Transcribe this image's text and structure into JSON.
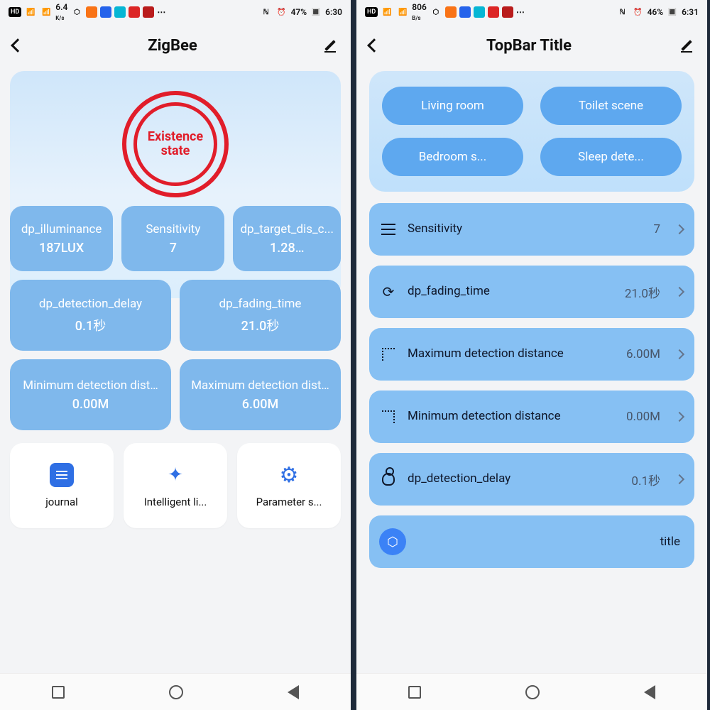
{
  "left": {
    "status": {
      "net_rate": "6.4",
      "net_unit": "K/s",
      "battery": "47%",
      "time": "6:30"
    },
    "title": "ZigBee",
    "ring_label": "Existence state",
    "tiles": {
      "r1": [
        {
          "label": "dp_illuminance",
          "value": "187LUX"
        },
        {
          "label": "Sensitivity",
          "value": "7"
        },
        {
          "label": "dp_target_dis_c...",
          "value": "1.28…"
        }
      ],
      "r2": [
        {
          "label": "dp_detection_delay",
          "value": "0.1秒"
        },
        {
          "label": "dp_fading_time",
          "value": "21.0秒"
        }
      ],
      "r3": [
        {
          "label": "Minimum detection dist…",
          "value": "0.00M"
        },
        {
          "label": "Maximum detection dist…",
          "value": "6.00M"
        }
      ]
    },
    "bottom": [
      {
        "label": "journal"
      },
      {
        "label": "Intelligent li..."
      },
      {
        "label": "Parameter s..."
      }
    ]
  },
  "right": {
    "status": {
      "net_rate": "806",
      "net_unit": "B/s",
      "battery": "46%",
      "time": "6:31"
    },
    "title": "TopBar Title",
    "scenes": [
      "Living room",
      "Toilet scene",
      "Bedroom s...",
      "Sleep dete..."
    ],
    "rows": [
      {
        "label": "Sensitivity",
        "value": "7"
      },
      {
        "label": "dp_fading_time",
        "value": "21.0秒"
      },
      {
        "label": "Maximum detection distance",
        "value": "6.00M"
      },
      {
        "label": "Minimum detection distance",
        "value": "0.00M"
      },
      {
        "label": "dp_detection_delay",
        "value": "0.1秒"
      }
    ],
    "last_row": {
      "label": "title"
    }
  }
}
